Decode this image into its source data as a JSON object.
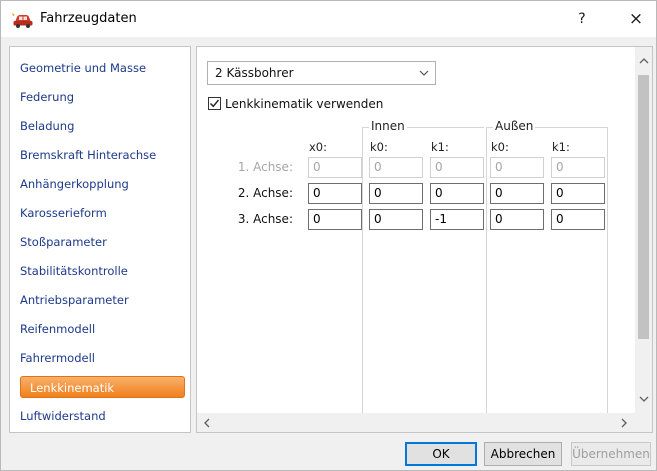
{
  "window": {
    "title": "Fahrzeugdaten",
    "help_label": "?",
    "close_label": "×"
  },
  "nav": {
    "items": [
      "Geometrie und Masse",
      "Federung",
      "Beladung",
      "Bremskraft Hinterachse",
      "Anhängerkopplung",
      "Karosserieform",
      "Stoßparameter",
      "Stabilitätskontrolle",
      "Antriebsparameter",
      "Reifenmodell",
      "Fahrermodell",
      "Lenkkinematik",
      "Luftwiderstand"
    ],
    "selected": "Lenkkinematik"
  },
  "panel": {
    "vehicle_select": "2 Kässbohrer",
    "use_kinematics_label": "Lenkkinematik verwenden",
    "use_kinematics_checked": true,
    "group_inner": "Innen",
    "group_outer": "Außen",
    "columns": [
      "x0:",
      "k0:",
      "k1:",
      "k0:",
      "k1:"
    ],
    "rows": [
      {
        "label": "1. Achse:",
        "disabled": true,
        "values": [
          "0",
          "0",
          "0",
          "0",
          "0"
        ]
      },
      {
        "label": "2. Achse:",
        "disabled": false,
        "values": [
          "0",
          "0",
          "0",
          "0",
          "0"
        ]
      },
      {
        "label": "3. Achse:",
        "disabled": false,
        "values": [
          "0",
          "0",
          "-1",
          "0",
          "0"
        ]
      }
    ]
  },
  "buttons": {
    "ok": "OK",
    "cancel": "Abbrechen",
    "apply": "Übernehmen",
    "apply_enabled": false
  },
  "colors": {
    "selection_start": "#f9b06a",
    "selection_end": "#f1801d",
    "nav_text": "#1d3a8a"
  }
}
